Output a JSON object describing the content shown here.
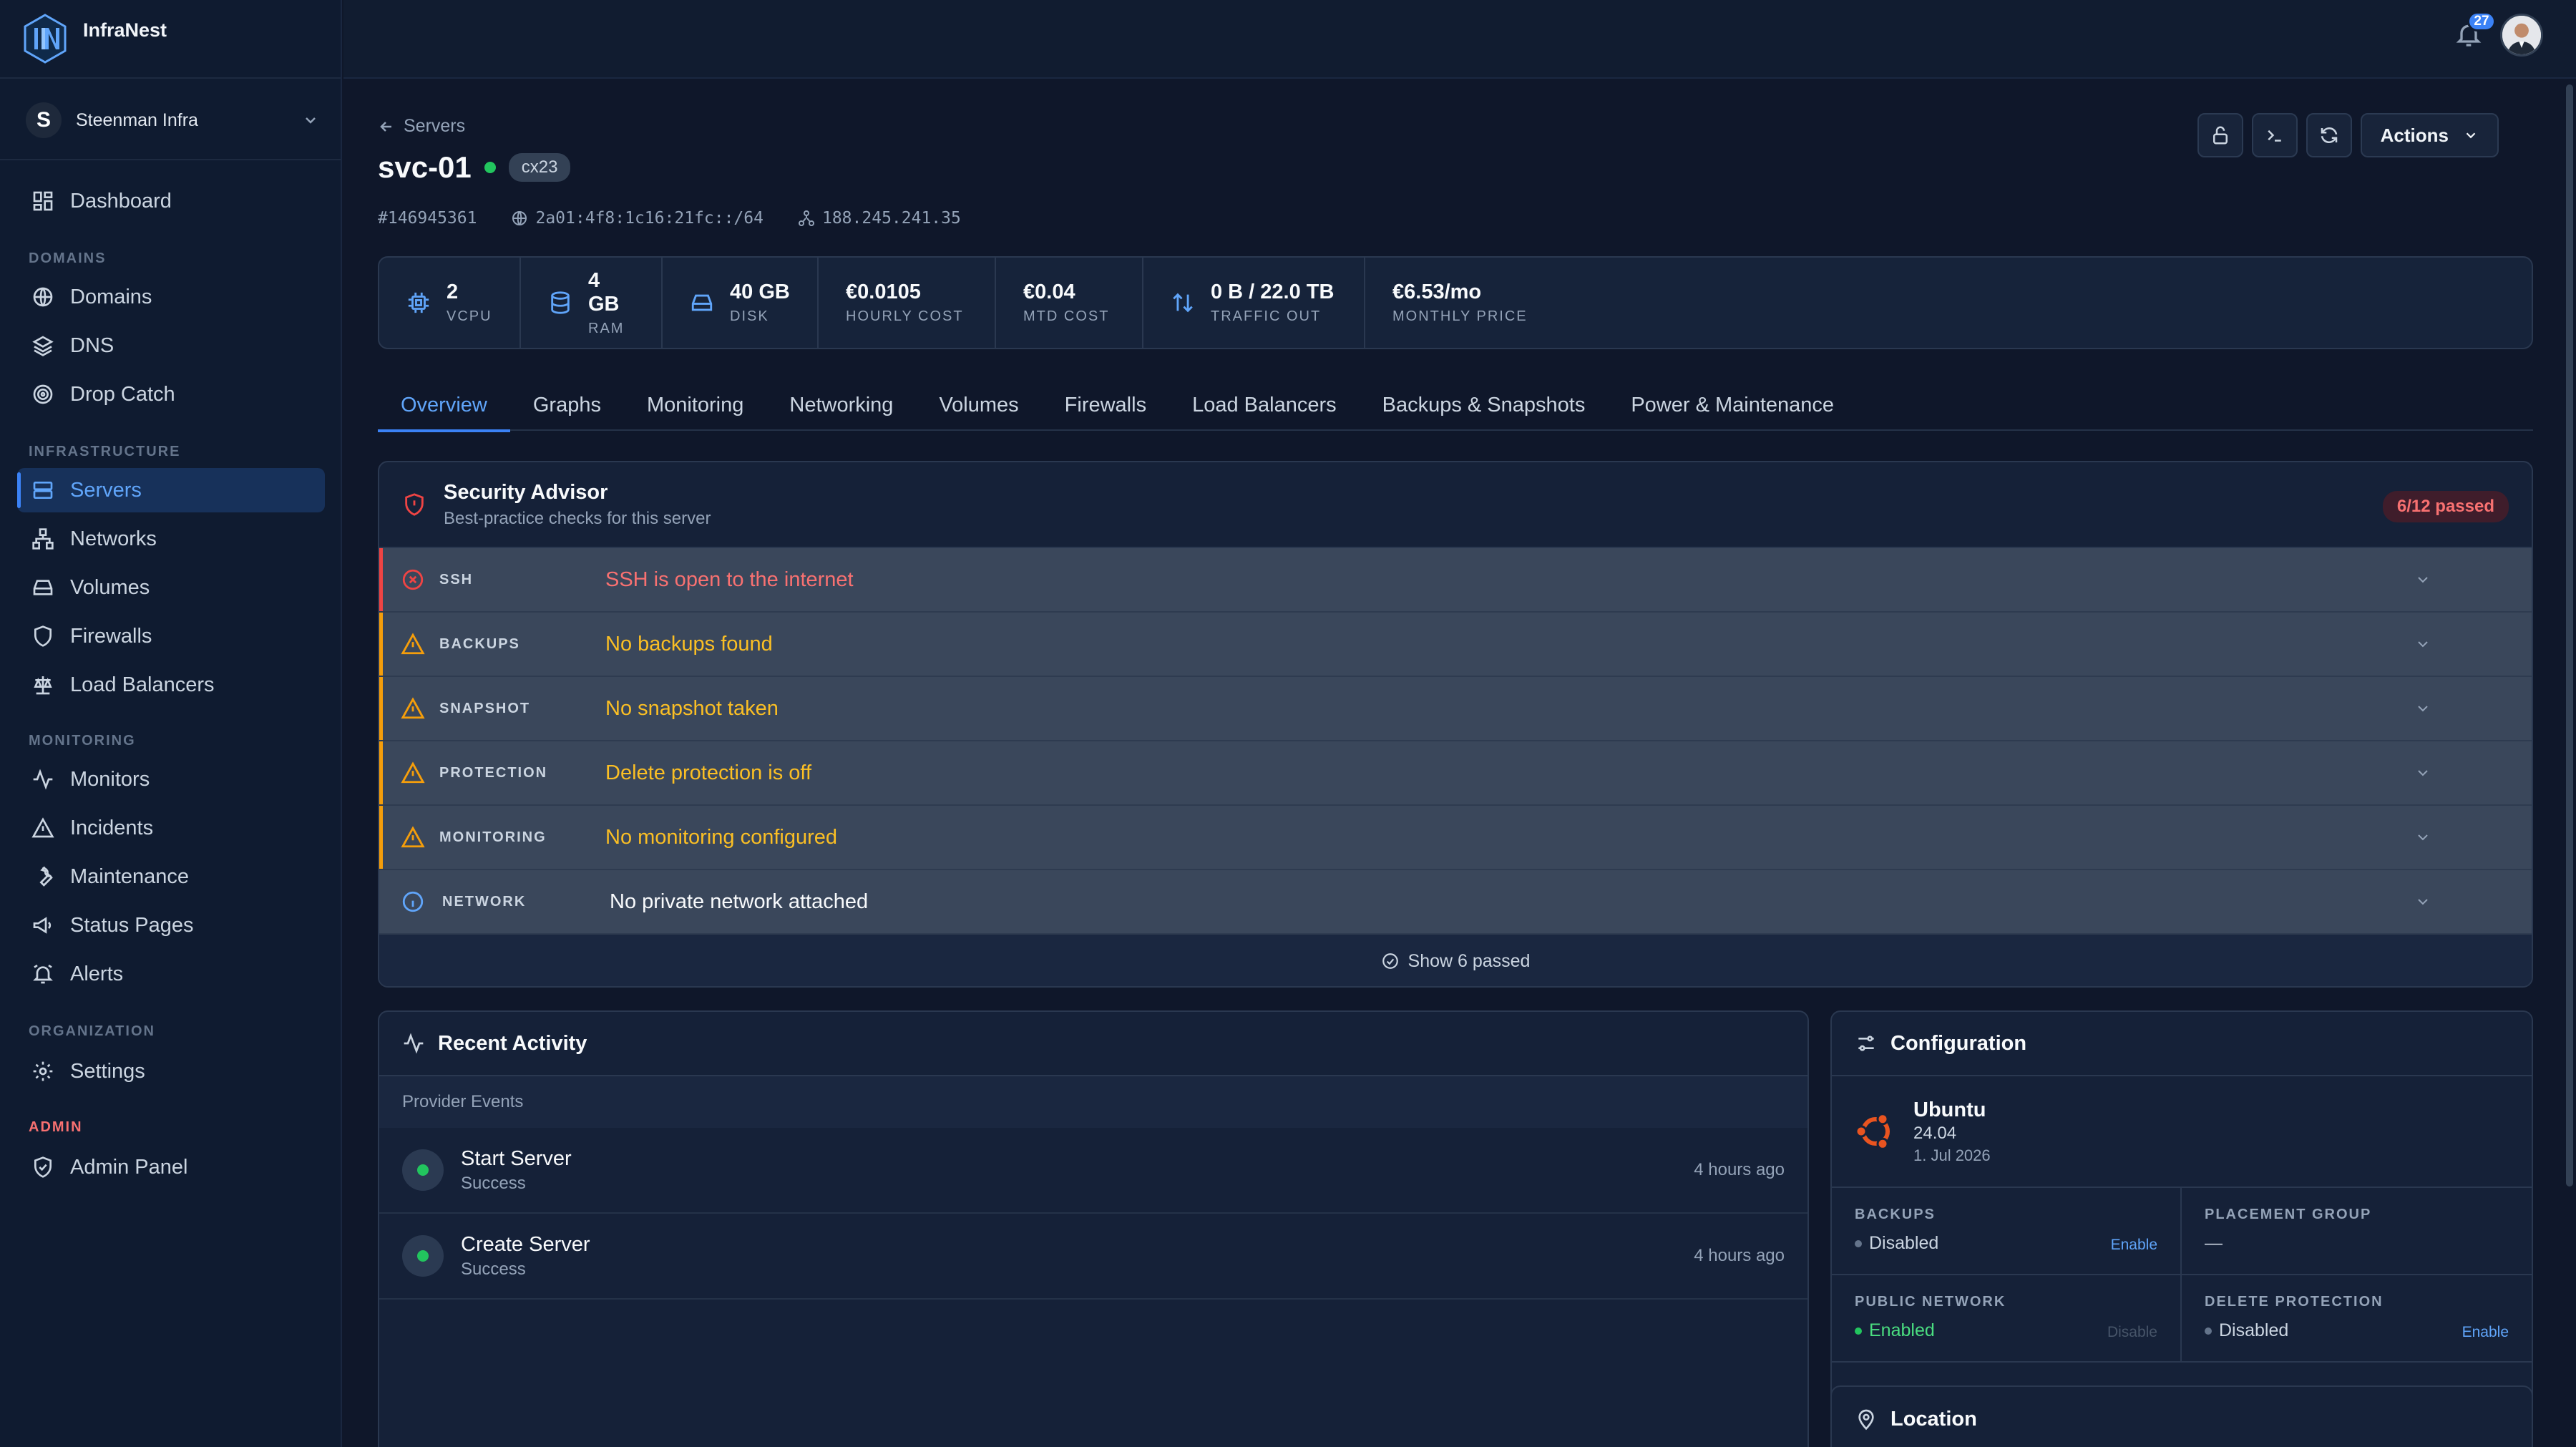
{
  "brand": {
    "name": "InfraNest"
  },
  "org": {
    "initial": "S",
    "name": "Steenman Infra"
  },
  "nav": {
    "dashboard": "Dashboard",
    "sec_domains": "DOMAINS",
    "domains": "Domains",
    "dns": "DNS",
    "drop_catch": "Drop Catch",
    "sec_infra": "INFRASTRUCTURE",
    "servers": "Servers",
    "networks": "Networks",
    "volumes": "Volumes",
    "firewalls": "Firewalls",
    "load_balancers": "Load Balancers",
    "sec_monitoring": "MONITORING",
    "monitors": "Monitors",
    "incidents": "Incidents",
    "maintenance": "Maintenance",
    "status_pages": "Status Pages",
    "alerts": "Alerts",
    "sec_org": "ORGANIZATION",
    "settings": "Settings",
    "sec_admin": "ADMIN",
    "admin_panel": "Admin Panel"
  },
  "topbar": {
    "notification_count": "27"
  },
  "page": {
    "breadcrumb": "Servers",
    "title": "svc-01",
    "type": "cx23",
    "id": "#146945361",
    "ipv6": "2a01:4f8:1c16:21fc::/64",
    "ipv4": "188.245.241.35",
    "actions_label": "Actions"
  },
  "stats": [
    {
      "value": "2",
      "label": "VCPU"
    },
    {
      "value": "4 GB",
      "label": "RAM"
    },
    {
      "value": "40 GB",
      "label": "DISK"
    },
    {
      "value": "€0.0105",
      "label": "HOURLY COST"
    },
    {
      "value": "€0.04",
      "label": "MTD COST"
    },
    {
      "value": "0 B / 22.0 TB",
      "label": "TRAFFIC OUT"
    },
    {
      "value": "€6.53/mo",
      "label": "MONTHLY PRICE"
    }
  ],
  "tabs": [
    "Overview",
    "Graphs",
    "Monitoring",
    "Networking",
    "Volumes",
    "Firewalls",
    "Load Balancers",
    "Backups & Snapshots",
    "Power & Maintenance"
  ],
  "security": {
    "title": "Security Advisor",
    "subtitle": "Best-practice checks for this server",
    "badge": "6/12 passed",
    "checks": [
      {
        "key": "SSH",
        "message": "SSH is open to the internet",
        "level": "error"
      },
      {
        "key": "BACKUPS",
        "message": "No backups found",
        "level": "warning"
      },
      {
        "key": "SNAPSHOT",
        "message": "No snapshot taken",
        "level": "warning"
      },
      {
        "key": "PROTECTION",
        "message": "Delete protection is off",
        "level": "warning"
      },
      {
        "key": "MONITORING",
        "message": "No monitoring configured",
        "level": "warning"
      },
      {
        "key": "NETWORK",
        "message": "No private network attached",
        "level": "info"
      }
    ],
    "show_passed": "Show 6 passed"
  },
  "activity": {
    "title": "Recent Activity",
    "subheader": "Provider Events",
    "events": [
      {
        "title": "Start Server",
        "status": "Success",
        "time": "4 hours ago"
      },
      {
        "title": "Create Server",
        "status": "Success",
        "time": "4 hours ago"
      }
    ]
  },
  "configuration": {
    "title": "Configuration",
    "os_name": "Ubuntu",
    "os_version": "24.04",
    "os_date": "1. Jul 2026",
    "backups_label": "BACKUPS",
    "backups_value": "Disabled",
    "backups_action": "Enable",
    "placement_label": "PLACEMENT GROUP",
    "placement_value": "—",
    "public_label": "PUBLIC NETWORK",
    "public_value": "Enabled",
    "public_action": "Disable",
    "protection_label": "DELETE PROTECTION",
    "protection_value": "Disabled",
    "protection_action": "Enable"
  },
  "location": {
    "title": "Location"
  },
  "colors": {
    "accent": "#3b82f6",
    "error": "#ef4444",
    "warning": "#f59e0b",
    "success": "#22c55e",
    "ubuntu": "#e95420"
  }
}
